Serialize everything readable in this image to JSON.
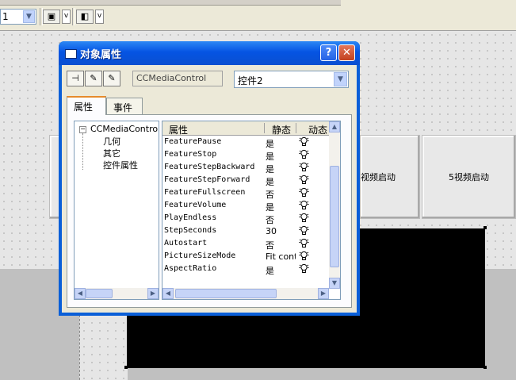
{
  "toolbar": {
    "combo_value": "1",
    "v_label": "v"
  },
  "canvas": {
    "button5_label": "5视频启动",
    "button4_label": "视频启动"
  },
  "dialog": {
    "title": "对象属性",
    "help_label": "?",
    "close_label": "✕",
    "class_name": "CCMediaControl",
    "object_name": "控件2",
    "tabs": [
      {
        "label": "属性",
        "active": true
      },
      {
        "label": "事件",
        "active": false
      }
    ],
    "tree": {
      "root": "CCMediaControl",
      "children": [
        "几何",
        "其它",
        "控件属性"
      ]
    },
    "props": {
      "headers": {
        "name": "属性",
        "static": "静态",
        "dynamic": "动态"
      },
      "rows": [
        {
          "name": "FeaturePause",
          "value": "是"
        },
        {
          "name": "FeatureStop",
          "value": "是"
        },
        {
          "name": "FeatureStepBackward",
          "value": "是"
        },
        {
          "name": "FeatureStepForward",
          "value": "是"
        },
        {
          "name": "FeatureFullscreen",
          "value": "否"
        },
        {
          "name": "FeatureVolume",
          "value": "是"
        },
        {
          "name": "PlayEndless",
          "value": "否"
        },
        {
          "name": "StepSeconds",
          "value": "30"
        },
        {
          "name": "Autostart",
          "value": "否"
        },
        {
          "name": "PictureSizeMode",
          "value": "Fit content"
        },
        {
          "name": "AspectRatio",
          "value": "是"
        }
      ]
    }
  }
}
